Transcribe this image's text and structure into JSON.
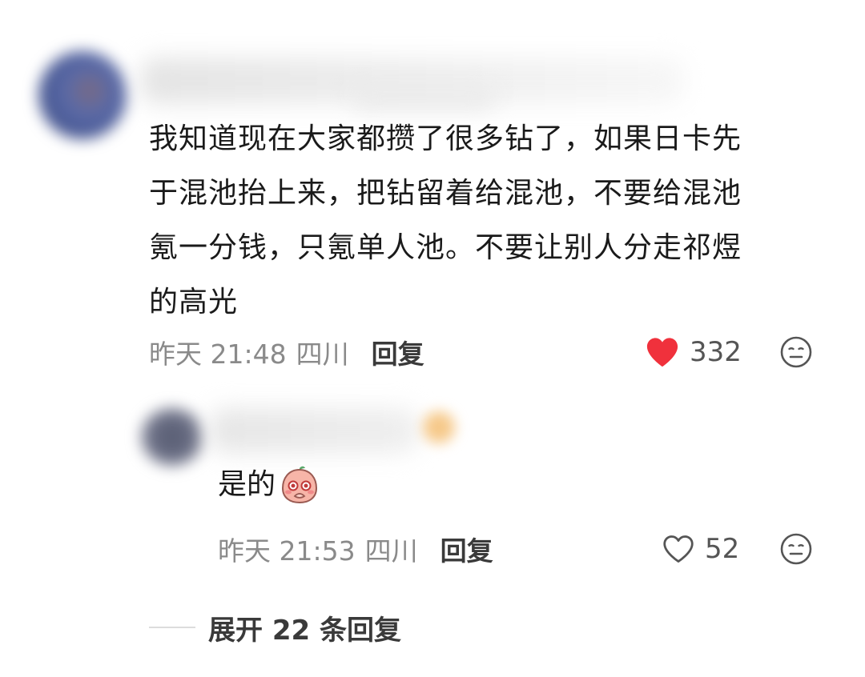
{
  "comment": {
    "lines": [
      "我知道现在大家都攒了很多钻了，如果日卡先",
      "于混池抬上来，把钻留着给混池，不要给混池",
      "氪一分钱，只氪单人池。不要让别人分走祁煜",
      "的高光"
    ],
    "time": "昨天 21:48",
    "location": "四川",
    "reply_label": "回复",
    "likes": "332",
    "liked": true
  },
  "reply": {
    "text": "是的",
    "sticker_icon": "blushing-peach-sticker-icon",
    "time": "昨天 21:53",
    "location": "四川",
    "reply_label": "回复",
    "likes": "52",
    "liked": false
  },
  "expand": {
    "label": "展开 22 条回复"
  },
  "colors": {
    "liked_heart": "#f0313c",
    "text_primary": "#1a1a1a",
    "text_meta": "#8a8a8a"
  }
}
